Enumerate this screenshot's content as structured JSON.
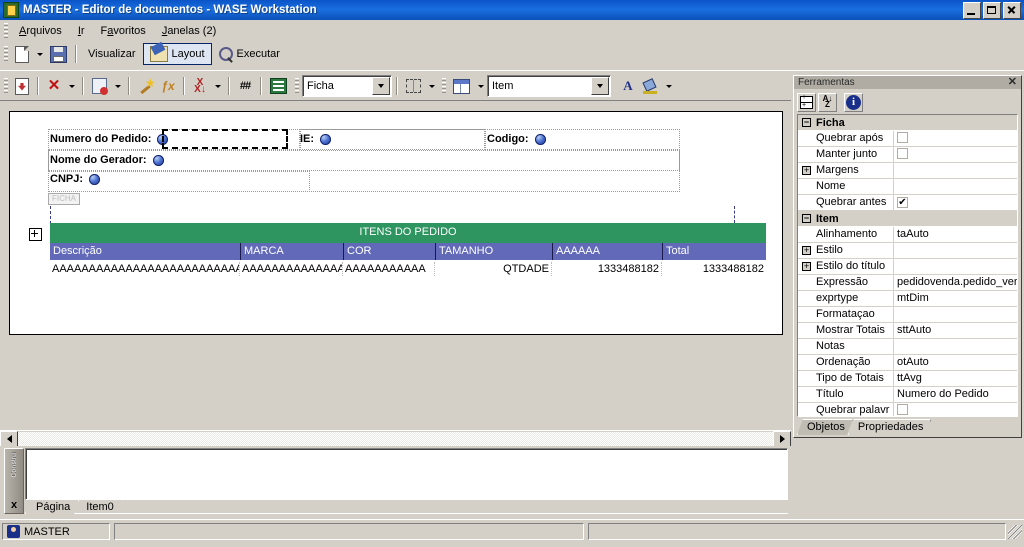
{
  "window": {
    "title": "MASTER - Editor de documentos - WASE Workstation",
    "icon": "app-icon",
    "minimize_label": "Minimizar",
    "maximize_label": "Maximizar",
    "close_label": "Fechar"
  },
  "menu": {
    "items": [
      {
        "label": "Arquivos",
        "accel": "A"
      },
      {
        "label": "Ir",
        "accel": "I"
      },
      {
        "label": "Favoritos",
        "accel": "a"
      },
      {
        "label": "Janelas (2)",
        "accel": "J"
      }
    ]
  },
  "toolbar_main": {
    "new_label": "",
    "new_icon": "new-page-icon",
    "save_icon": "save-icon",
    "visualizar_label": "Visualizar",
    "layout_label": "Layout",
    "layout_icon": "layout-ruler-icon",
    "executar_label": "Executar",
    "executar_icon": "execute-magnifier-icon",
    "active": "Layout"
  },
  "toolbar_second": {
    "import_icon": "import-icon",
    "delete_icon": "delete-x-icon",
    "field_icon": "new-field-icon",
    "wizard_icon": "wizard-wand-icon",
    "function_icon": "function-fx-icon",
    "sort_icon": "sort-az-icon",
    "number_icon": "number-hash-icon",
    "export_icon": "export-excel-icon",
    "style_value": "Ficha",
    "grid_icon": "grid-border-icon",
    "table_icon": "table-icon",
    "object_value": "Item",
    "font_icon": "font-color-icon",
    "fill_icon": "fill-color-icon"
  },
  "canvas": {
    "move_handle": "move-handle",
    "band_tag": "FICHA",
    "fields": [
      {
        "label": "Numero do Pedido:",
        "selected": true
      },
      {
        "label": "IE:",
        "selected": false
      },
      {
        "label": "Codigo:",
        "selected": false
      },
      {
        "label": "Nome do Gerador:",
        "selected": false
      },
      {
        "label": "CNPJ:",
        "selected": false
      }
    ],
    "table": {
      "title": "ITENS DO PEDIDO",
      "title_bg": "#2e9460",
      "header_bg": "#6169b8",
      "columns": [
        "Descrição",
        "MARCA",
        "COR",
        "TAMANHO",
        "AAAAAA",
        "Total"
      ],
      "row": [
        "AAAAAAAAAAAAAAAAAAAAAAAAAA",
        "AAAAAAAAAAAAAA",
        "AAAAAAAAAAA",
        "QTDADE",
        "1333488182",
        "1333488182"
      ]
    }
  },
  "dock": {
    "side_label": "Constru",
    "close_label": "x",
    "tabs": [
      {
        "label": "Página",
        "active": true
      },
      {
        "label": "Item0",
        "active": false
      }
    ]
  },
  "toolpanel": {
    "title": "Ferramentas",
    "close_label": "✕",
    "buttons": [
      {
        "name": "categorize-button",
        "glyph": ""
      },
      {
        "name": "sort-alpha-button",
        "glyph": "A\\nZ"
      },
      {
        "name": "info-button",
        "glyph": "i"
      }
    ],
    "groups": [
      {
        "name": "Ficha",
        "expanded": true,
        "rows": [
          {
            "name": "Quebrar após",
            "type": "checkbox",
            "checked": false,
            "expandable": false
          },
          {
            "name": "Manter junto",
            "type": "checkbox",
            "checked": false,
            "expandable": false
          },
          {
            "name": "Margens",
            "type": "text",
            "value": "",
            "expandable": true
          },
          {
            "name": "Nome",
            "type": "text",
            "value": "",
            "expandable": false
          },
          {
            "name": "Quebrar antes",
            "type": "checkbox",
            "checked": true,
            "expandable": false
          }
        ]
      },
      {
        "name": "Item",
        "expanded": true,
        "rows": [
          {
            "name": "Alinhamento",
            "type": "text",
            "value": "taAuto",
            "expandable": false
          },
          {
            "name": "Estilo",
            "type": "text",
            "value": "",
            "expandable": true
          },
          {
            "name": "Estilo do título",
            "type": "text",
            "value": "",
            "expandable": true
          },
          {
            "name": "Expressão",
            "type": "text",
            "value": "pedidovenda.pedido_ver",
            "expandable": false
          },
          {
            "name": "exprtype",
            "type": "text",
            "value": "mtDim",
            "expandable": false
          },
          {
            "name": "Formataçao",
            "type": "text",
            "value": "",
            "expandable": false
          },
          {
            "name": "Mostrar Totais",
            "type": "text",
            "value": "sttAuto",
            "expandable": false
          },
          {
            "name": "Notas",
            "type": "text",
            "value": "",
            "expandable": false
          },
          {
            "name": "Ordenação",
            "type": "text",
            "value": "otAuto",
            "expandable": false
          },
          {
            "name": "Tipo de Totais",
            "type": "text",
            "value": "ttAvg",
            "expandable": false
          },
          {
            "name": "Título",
            "type": "text",
            "value": "Numero do Pedido",
            "expandable": false
          },
          {
            "name": "Quebrar palavr",
            "type": "checkbox",
            "checked": false,
            "expandable": false
          }
        ]
      }
    ],
    "tabs": [
      {
        "label": "Objetos",
        "selected": true
      },
      {
        "label": "Propriedades",
        "selected": false
      }
    ]
  },
  "statusbar": {
    "user": "MASTER",
    "pane2": "",
    "pane3": ""
  }
}
